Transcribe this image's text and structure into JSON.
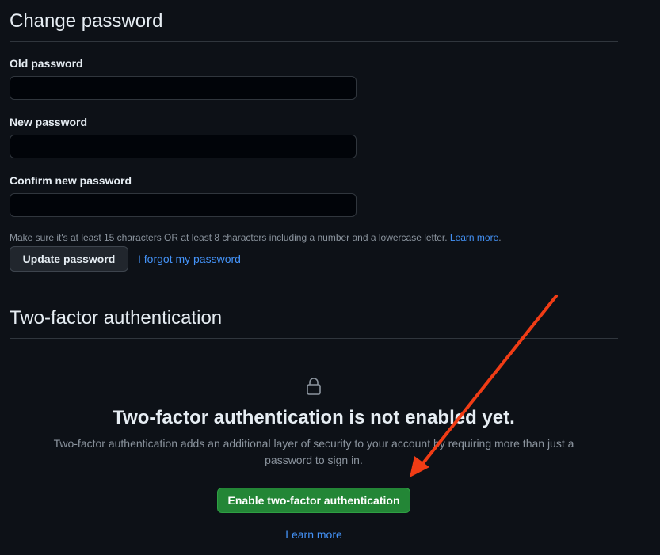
{
  "change_password": {
    "title": "Change password",
    "old_label": "Old password",
    "old_value": "",
    "new_label": "New password",
    "new_value": "",
    "confirm_label": "Confirm new password",
    "confirm_value": "",
    "hint_text": "Make sure it's at least 15 characters OR at least 8 characters including a number and a lowercase letter.",
    "hint_link": "Learn more",
    "hint_suffix": ".",
    "update_button": "Update password",
    "forgot_link": "I forgot my password"
  },
  "two_factor": {
    "title": "Two-factor authentication",
    "icon": "lock-icon",
    "blank_title": "Two-factor authentication is not enabled yet.",
    "blank_description": "Two-factor authentication adds an additional layer of security to your account by requiring more than just a password to sign in.",
    "enable_button": "Enable two-factor authentication",
    "learn_more": "Learn more"
  },
  "annotation": {
    "arrow_color": "#f03c15"
  },
  "colors": {
    "background": "#0d1117",
    "link": "#4493f8",
    "primary_button": "#238636"
  }
}
